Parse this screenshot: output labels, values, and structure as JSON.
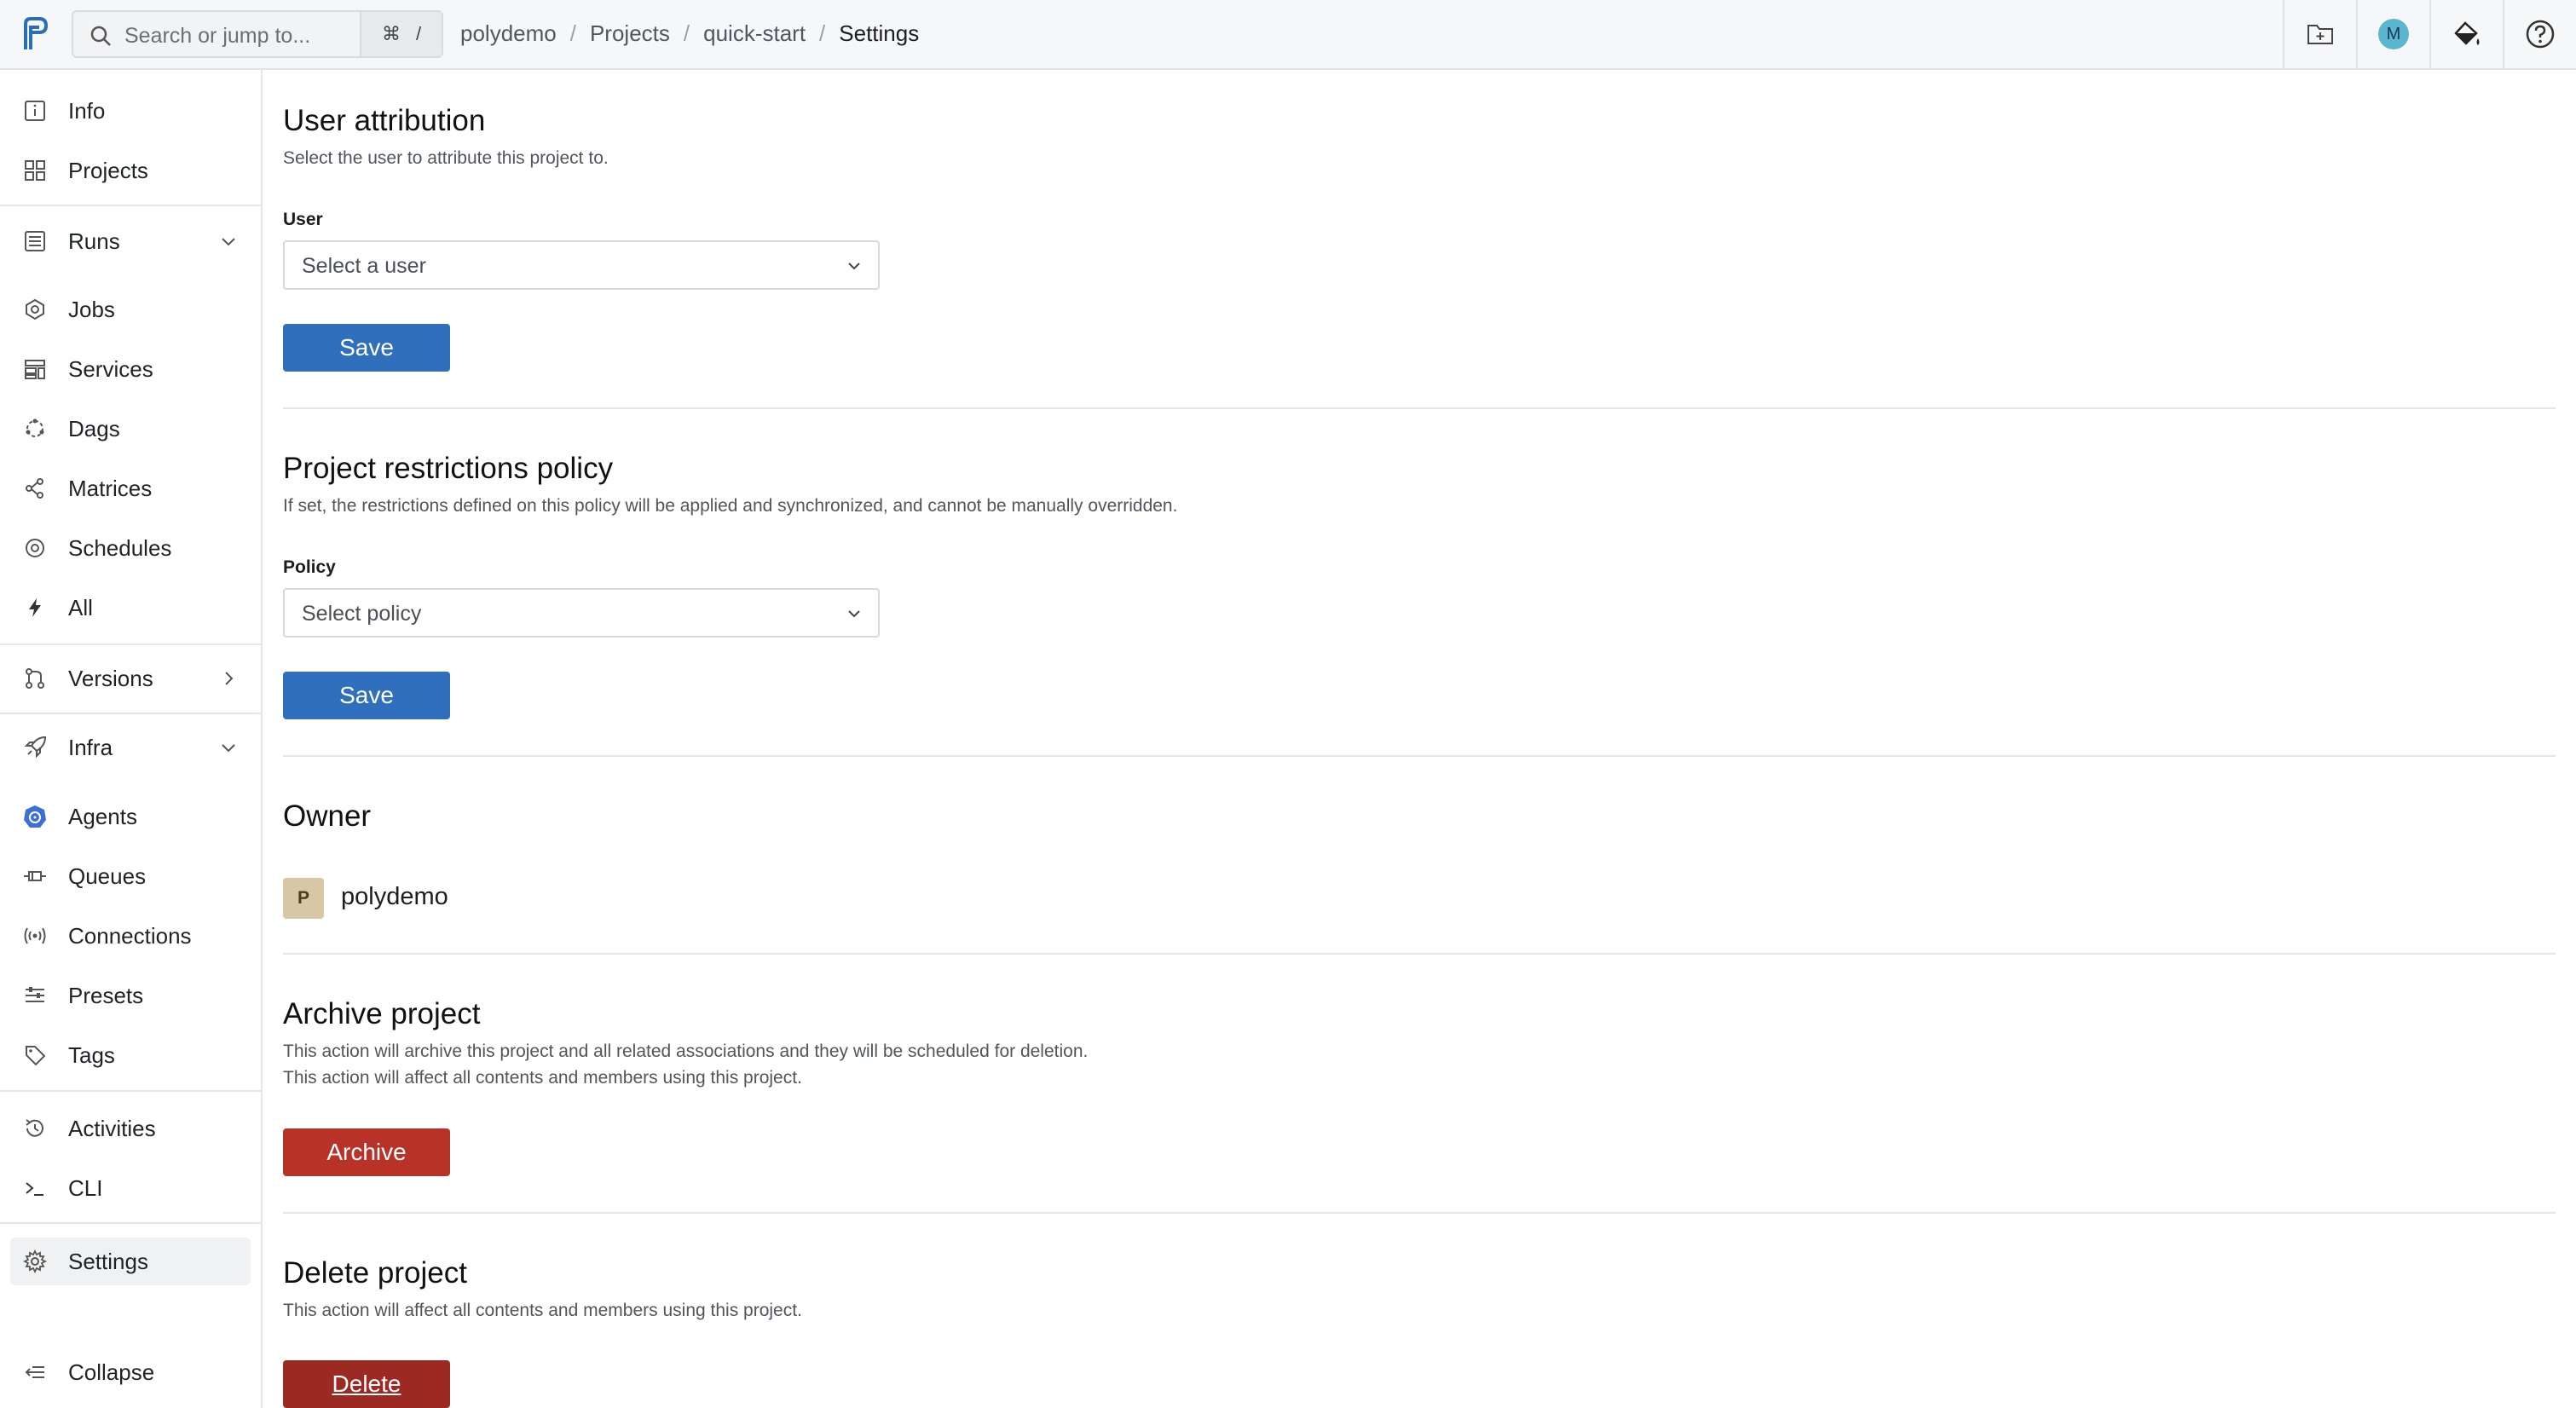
{
  "search": {
    "placeholder": "Search or jump to...",
    "kbd1": "⌘",
    "kbd2": "/"
  },
  "breadcrumb": [
    "polydemo",
    "Projects",
    "quick-start",
    "Settings"
  ],
  "user_avatar": "M",
  "sidebar": {
    "items": [
      {
        "label": "Info"
      },
      {
        "label": "Projects"
      },
      {
        "label": "Runs"
      },
      {
        "label": "Jobs"
      },
      {
        "label": "Services"
      },
      {
        "label": "Dags"
      },
      {
        "label": "Matrices"
      },
      {
        "label": "Schedules"
      },
      {
        "label": "All"
      },
      {
        "label": "Versions"
      },
      {
        "label": "Infra"
      },
      {
        "label": "Agents"
      },
      {
        "label": "Queues"
      },
      {
        "label": "Connections"
      },
      {
        "label": "Presets"
      },
      {
        "label": "Tags"
      },
      {
        "label": "Activities"
      },
      {
        "label": "CLI"
      },
      {
        "label": "Settings"
      },
      {
        "label": "Collapse"
      }
    ]
  },
  "sections": {
    "user_attribution": {
      "title": "User attribution",
      "description": "Select the user to attribute this project to.",
      "field_label": "User",
      "select_value": "Select a user",
      "button": "Save"
    },
    "restrictions": {
      "title": "Project restrictions policy",
      "description": "If set, the restrictions defined on this policy will be applied and synchronized, and cannot be manually overridden.",
      "field_label": "Policy",
      "select_value": "Select policy",
      "button": "Save"
    },
    "owner": {
      "title": "Owner",
      "badge": "P",
      "name": "polydemo"
    },
    "archive": {
      "title": "Archive project",
      "line1": "This action will archive this project and all related associations and they will be scheduled for deletion.",
      "line2": "This action will affect all contents and members using this project.",
      "button": "Archive"
    },
    "delete": {
      "title": "Delete project",
      "description": "This action will affect all contents and members using this project.",
      "button": "Delete"
    }
  },
  "colors": {
    "primary": "#2f6fbb",
    "danger": "#b83228",
    "danger_dark": "#9c2a22"
  }
}
